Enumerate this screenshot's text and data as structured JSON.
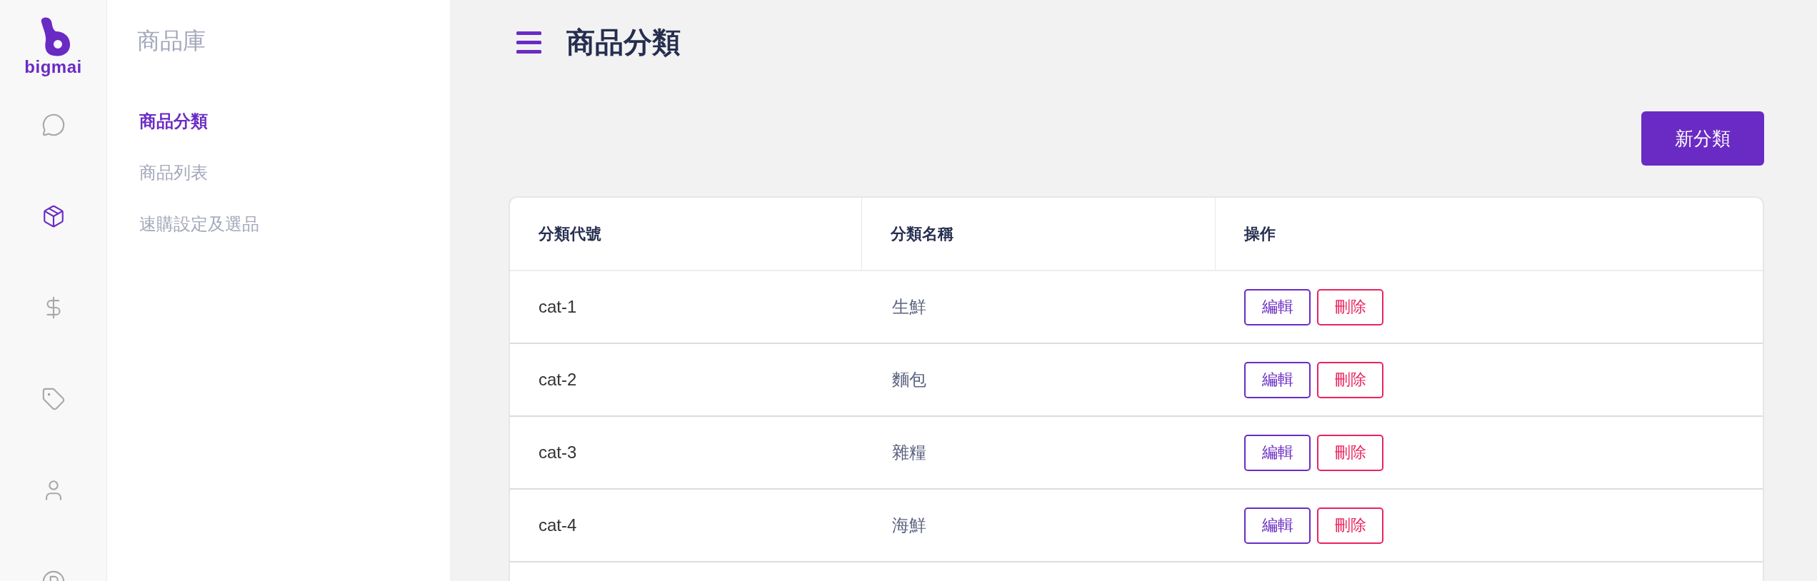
{
  "logo": {
    "text": "bigmai"
  },
  "nav_rail": [
    {
      "selected": false
    },
    {
      "selected": true
    },
    {
      "selected": false
    },
    {
      "selected": false
    },
    {
      "selected": false
    },
    {
      "selected": false
    }
  ],
  "sidebar": {
    "title": "商品庫",
    "items": [
      {
        "label": "商品分類",
        "selected": true
      },
      {
        "label": "商品列表",
        "selected": false
      },
      {
        "label": "速購設定及選品",
        "selected": false
      }
    ]
  },
  "header": {
    "title": "商品分類"
  },
  "new_button": {
    "label": "新分類"
  },
  "table": {
    "columns": [
      "分類代號",
      "分類名稱",
      "操作"
    ],
    "rows": [
      {
        "code": "cat-1",
        "name": "生鮮",
        "actions": [
          {
            "kind": "edit",
            "label": "編輯"
          },
          {
            "kind": "delete",
            "label": "刪除"
          }
        ]
      },
      {
        "code": "cat-2",
        "name": "麵包",
        "actions": [
          {
            "kind": "edit",
            "label": "編輯"
          },
          {
            "kind": "delete",
            "label": "刪除"
          }
        ]
      },
      {
        "code": "cat-3",
        "name": "雜糧",
        "actions": [
          {
            "kind": "edit",
            "label": "編輯"
          },
          {
            "kind": "delete",
            "label": "刪除"
          }
        ]
      },
      {
        "code": "cat-4",
        "name": "海鮮",
        "actions": [
          {
            "kind": "edit",
            "label": "編輯"
          },
          {
            "kind": "delete",
            "label": "刪除"
          }
        ]
      }
    ]
  }
}
